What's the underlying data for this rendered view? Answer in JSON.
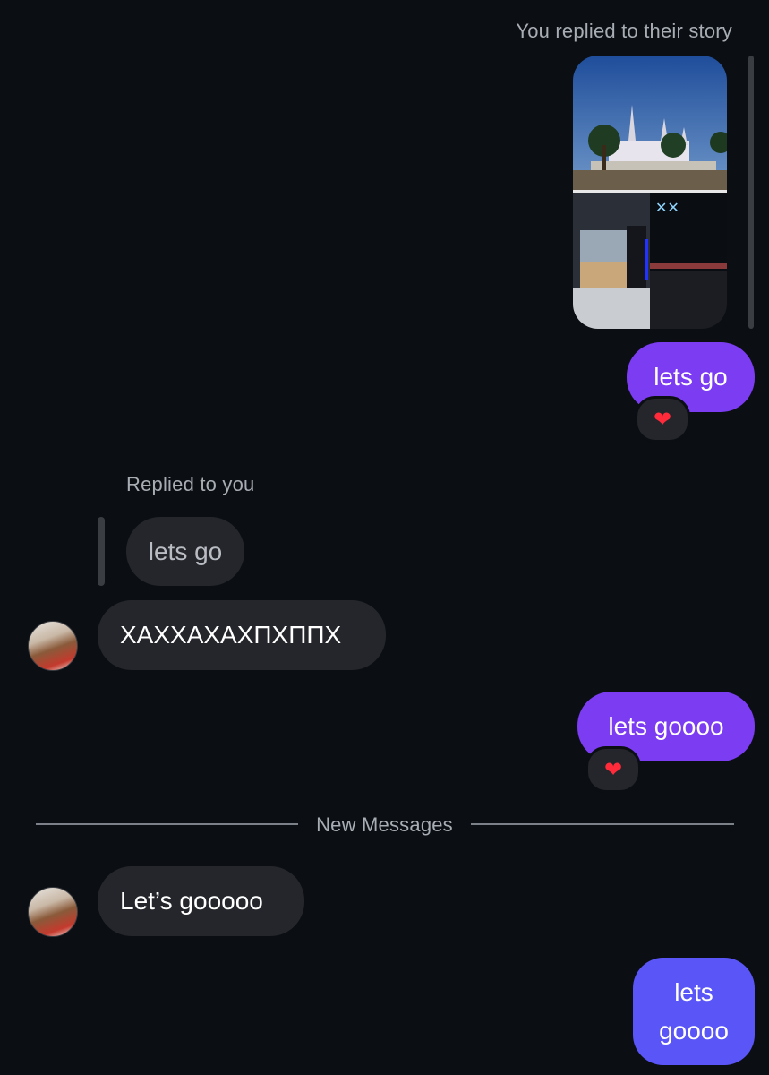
{
  "story_reply": {
    "label": "You replied to their story"
  },
  "messages": {
    "out_1": {
      "text": "lets go",
      "reaction": "❤"
    },
    "reply_label": "Replied to you",
    "quoted": "lets go",
    "in_1": "ХАХХАХАХПХППХ",
    "out_2": {
      "text": "lets goooo",
      "reaction": "❤"
    },
    "divider": "New Messages",
    "in_2": "Let’s gooooo",
    "out_3": {
      "line1": "lets",
      "line2": "goooo"
    }
  },
  "colors": {
    "background": "#0b0f14",
    "outgoing_bubble": "#7b3cf2",
    "outgoing_bubble_last": "#5a55f6",
    "incoming_bubble": "#24262b"
  }
}
